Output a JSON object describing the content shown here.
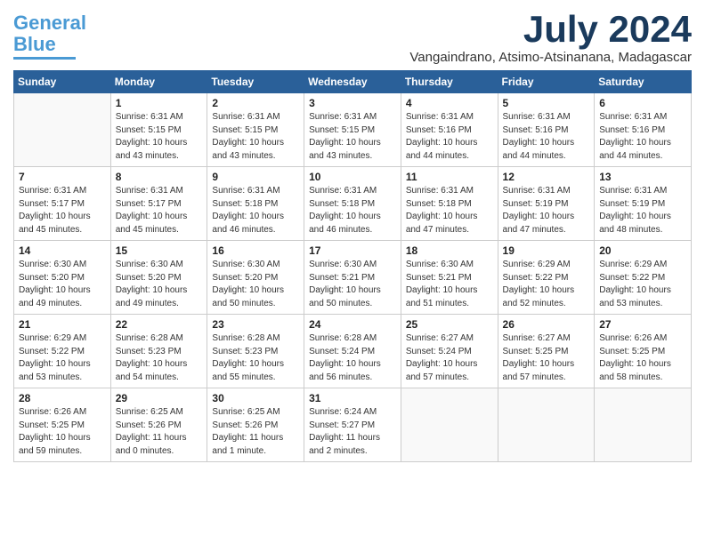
{
  "logo": {
    "line1": "General",
    "line2": "Blue"
  },
  "title": "July 2024",
  "subtitle": "Vangaindrano, Atsimo-Atsinanana, Madagascar",
  "weekdays": [
    "Sunday",
    "Monday",
    "Tuesday",
    "Wednesday",
    "Thursday",
    "Friday",
    "Saturday"
  ],
  "weeks": [
    [
      {
        "day": "",
        "info": ""
      },
      {
        "day": "1",
        "info": "Sunrise: 6:31 AM\nSunset: 5:15 PM\nDaylight: 10 hours\nand 43 minutes."
      },
      {
        "day": "2",
        "info": "Sunrise: 6:31 AM\nSunset: 5:15 PM\nDaylight: 10 hours\nand 43 minutes."
      },
      {
        "day": "3",
        "info": "Sunrise: 6:31 AM\nSunset: 5:15 PM\nDaylight: 10 hours\nand 43 minutes."
      },
      {
        "day": "4",
        "info": "Sunrise: 6:31 AM\nSunset: 5:16 PM\nDaylight: 10 hours\nand 44 minutes."
      },
      {
        "day": "5",
        "info": "Sunrise: 6:31 AM\nSunset: 5:16 PM\nDaylight: 10 hours\nand 44 minutes."
      },
      {
        "day": "6",
        "info": "Sunrise: 6:31 AM\nSunset: 5:16 PM\nDaylight: 10 hours\nand 44 minutes."
      }
    ],
    [
      {
        "day": "7",
        "info": "Sunrise: 6:31 AM\nSunset: 5:17 PM\nDaylight: 10 hours\nand 45 minutes."
      },
      {
        "day": "8",
        "info": "Sunrise: 6:31 AM\nSunset: 5:17 PM\nDaylight: 10 hours\nand 45 minutes."
      },
      {
        "day": "9",
        "info": "Sunrise: 6:31 AM\nSunset: 5:18 PM\nDaylight: 10 hours\nand 46 minutes."
      },
      {
        "day": "10",
        "info": "Sunrise: 6:31 AM\nSunset: 5:18 PM\nDaylight: 10 hours\nand 46 minutes."
      },
      {
        "day": "11",
        "info": "Sunrise: 6:31 AM\nSunset: 5:18 PM\nDaylight: 10 hours\nand 47 minutes."
      },
      {
        "day": "12",
        "info": "Sunrise: 6:31 AM\nSunset: 5:19 PM\nDaylight: 10 hours\nand 47 minutes."
      },
      {
        "day": "13",
        "info": "Sunrise: 6:31 AM\nSunset: 5:19 PM\nDaylight: 10 hours\nand 48 minutes."
      }
    ],
    [
      {
        "day": "14",
        "info": "Sunrise: 6:30 AM\nSunset: 5:20 PM\nDaylight: 10 hours\nand 49 minutes."
      },
      {
        "day": "15",
        "info": "Sunrise: 6:30 AM\nSunset: 5:20 PM\nDaylight: 10 hours\nand 49 minutes."
      },
      {
        "day": "16",
        "info": "Sunrise: 6:30 AM\nSunset: 5:20 PM\nDaylight: 10 hours\nand 50 minutes."
      },
      {
        "day": "17",
        "info": "Sunrise: 6:30 AM\nSunset: 5:21 PM\nDaylight: 10 hours\nand 50 minutes."
      },
      {
        "day": "18",
        "info": "Sunrise: 6:30 AM\nSunset: 5:21 PM\nDaylight: 10 hours\nand 51 minutes."
      },
      {
        "day": "19",
        "info": "Sunrise: 6:29 AM\nSunset: 5:22 PM\nDaylight: 10 hours\nand 52 minutes."
      },
      {
        "day": "20",
        "info": "Sunrise: 6:29 AM\nSunset: 5:22 PM\nDaylight: 10 hours\nand 53 minutes."
      }
    ],
    [
      {
        "day": "21",
        "info": "Sunrise: 6:29 AM\nSunset: 5:22 PM\nDaylight: 10 hours\nand 53 minutes."
      },
      {
        "day": "22",
        "info": "Sunrise: 6:28 AM\nSunset: 5:23 PM\nDaylight: 10 hours\nand 54 minutes."
      },
      {
        "day": "23",
        "info": "Sunrise: 6:28 AM\nSunset: 5:23 PM\nDaylight: 10 hours\nand 55 minutes."
      },
      {
        "day": "24",
        "info": "Sunrise: 6:28 AM\nSunset: 5:24 PM\nDaylight: 10 hours\nand 56 minutes."
      },
      {
        "day": "25",
        "info": "Sunrise: 6:27 AM\nSunset: 5:24 PM\nDaylight: 10 hours\nand 57 minutes."
      },
      {
        "day": "26",
        "info": "Sunrise: 6:27 AM\nSunset: 5:25 PM\nDaylight: 10 hours\nand 57 minutes."
      },
      {
        "day": "27",
        "info": "Sunrise: 6:26 AM\nSunset: 5:25 PM\nDaylight: 10 hours\nand 58 minutes."
      }
    ],
    [
      {
        "day": "28",
        "info": "Sunrise: 6:26 AM\nSunset: 5:25 PM\nDaylight: 10 hours\nand 59 minutes."
      },
      {
        "day": "29",
        "info": "Sunrise: 6:25 AM\nSunset: 5:26 PM\nDaylight: 11 hours\nand 0 minutes."
      },
      {
        "day": "30",
        "info": "Sunrise: 6:25 AM\nSunset: 5:26 PM\nDaylight: 11 hours\nand 1 minute."
      },
      {
        "day": "31",
        "info": "Sunrise: 6:24 AM\nSunset: 5:27 PM\nDaylight: 11 hours\nand 2 minutes."
      },
      {
        "day": "",
        "info": ""
      },
      {
        "day": "",
        "info": ""
      },
      {
        "day": "",
        "info": ""
      }
    ]
  ]
}
